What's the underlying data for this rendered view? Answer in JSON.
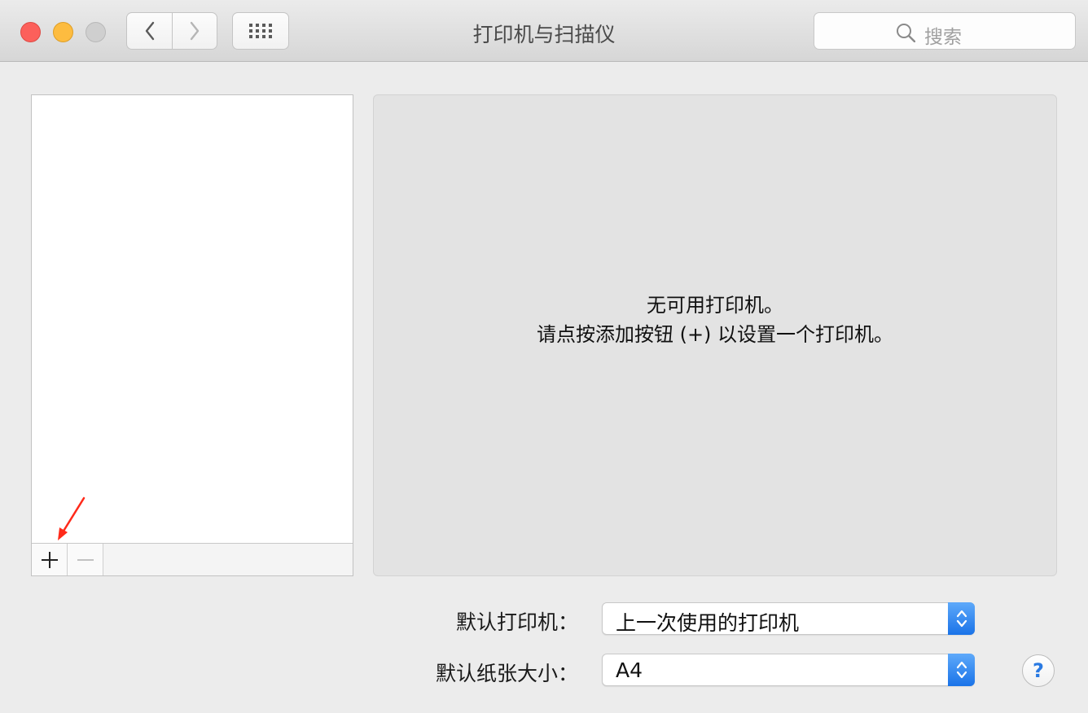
{
  "window": {
    "title": "打印机与扫描仪",
    "search_placeholder": "搜索"
  },
  "detail": {
    "message_line1": "无可用打印机。",
    "message_line2": "请点按添加按钮 (+) 以设置一个打印机。"
  },
  "form": {
    "default_printer_label": "默认打印机：",
    "default_printer_value": "上一次使用的打印机",
    "paper_size_label": "默认纸张大小：",
    "paper_size_value": "A4"
  },
  "help": {
    "label": "?"
  },
  "colors": {
    "close": "#fc605b",
    "minimize": "#fdbc40",
    "accent": "#1a73e8",
    "annotation_arrow": "#ff2a1a"
  },
  "icons": [
    "chevron-left-icon",
    "chevron-right-icon",
    "grid-icon",
    "search-icon",
    "plus-icon",
    "minus-icon",
    "up-down-chevron-icon"
  ]
}
